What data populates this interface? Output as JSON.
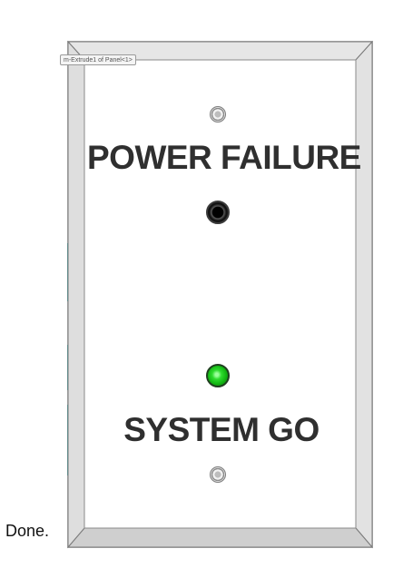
{
  "panel": {
    "tooltip": "m-Extrude1 of Panel<1>",
    "power_label": "POWER FAILURE",
    "system_label": "SYSTEM GO",
    "power_led_state": "off",
    "system_led_state": "on",
    "colors": {
      "frame": "#d9d9d9",
      "face": "#ffffff",
      "text": "#2f2f2f",
      "led_on": "#22cc22",
      "led_off": "#000000",
      "highlight": "#33d6d6"
    }
  },
  "status": {
    "text": "Done."
  }
}
